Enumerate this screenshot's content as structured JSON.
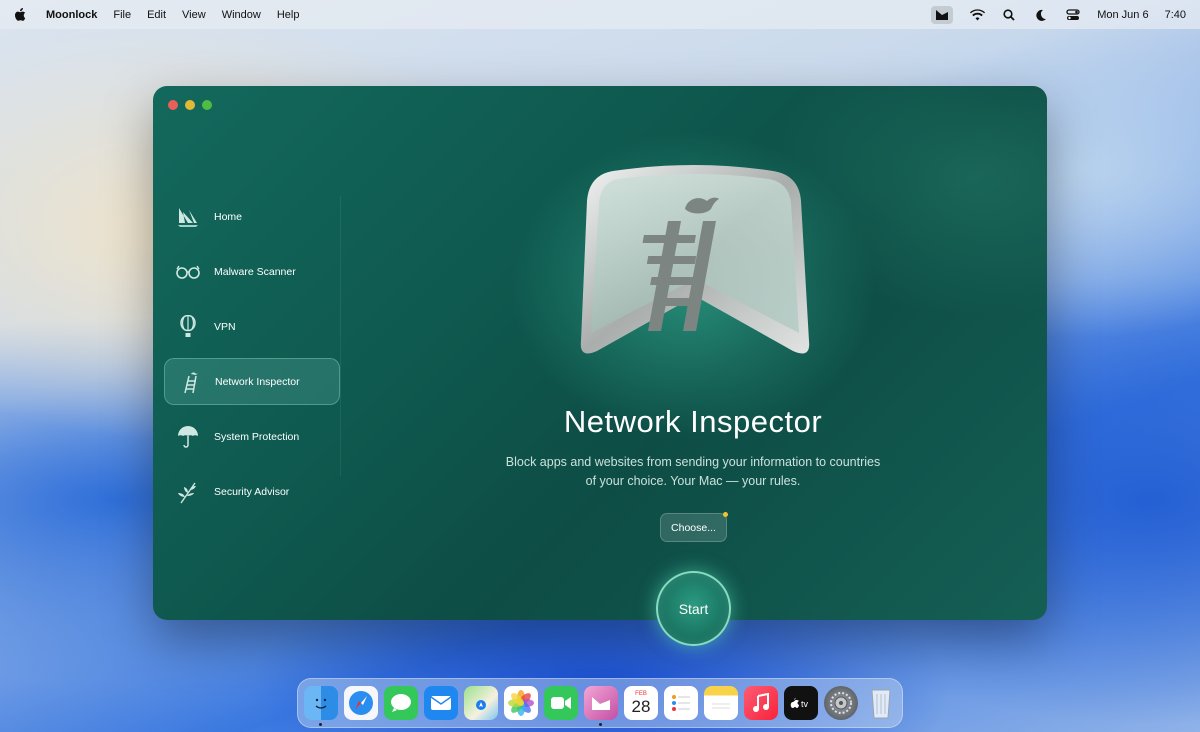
{
  "menubar": {
    "app_name": "Moonlock",
    "menus": [
      "File",
      "Edit",
      "View",
      "Window",
      "Help"
    ],
    "date": "Mon Jun 6",
    "time": "7:40"
  },
  "sidebar": {
    "items": [
      {
        "label": "Home",
        "icon": "home-icon"
      },
      {
        "label": "Malware Scanner",
        "icon": "glasses-icon"
      },
      {
        "label": "VPN",
        "icon": "balloon-icon"
      },
      {
        "label": "Network Inspector",
        "icon": "ladder-bird-icon",
        "active": true
      },
      {
        "label": "System Protection",
        "icon": "umbrella-icon"
      },
      {
        "label": "Security Advisor",
        "icon": "leaves-icon"
      }
    ]
  },
  "main": {
    "title": "Network Inspector",
    "subtitle_line1": "Block apps and websites from sending your information to countries",
    "subtitle_line2": "of your choice. Your Mac — your rules.",
    "choose_label": "Choose...",
    "start_label": "Start"
  },
  "dock": {
    "apps": [
      "Finder",
      "Safari",
      "Messages",
      "Mail",
      "Maps",
      "Photos",
      "FaceTime",
      "Moonlock",
      "Calendar",
      "Reminders",
      "Notes",
      "Music",
      "TV",
      "System Settings",
      "Trash"
    ],
    "calendar_month": "FEB",
    "calendar_day": "28"
  },
  "colors": {
    "window_bg": "#0f5a50",
    "accent": "#2b9a80",
    "badge_dot": "#f4c430"
  }
}
